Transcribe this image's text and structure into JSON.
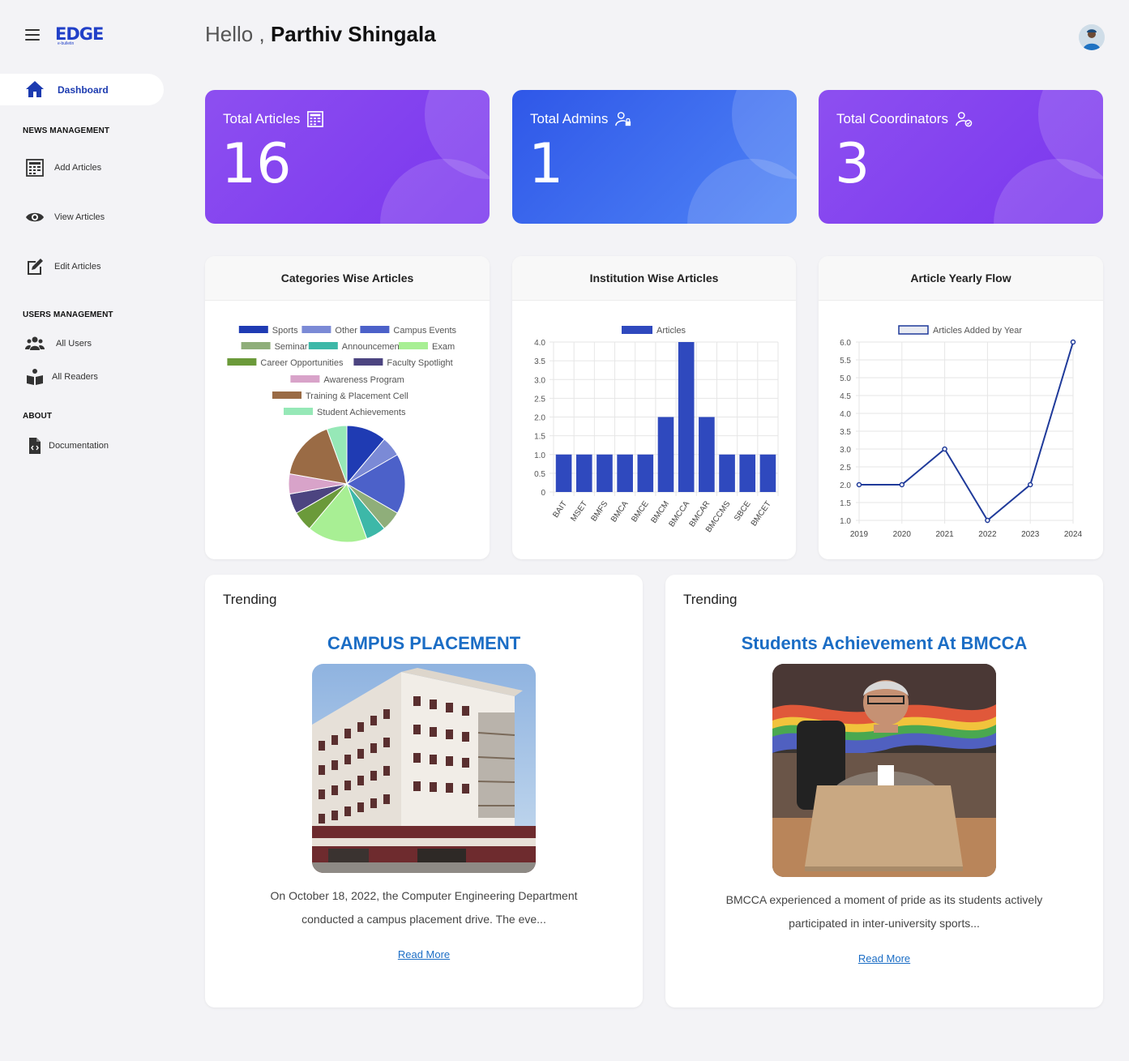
{
  "app": {
    "logo_text": "EDGE",
    "logo_sub": "e-bulletin"
  },
  "greeting": {
    "hello": "Hello ,",
    "name": "Parthiv Shingala"
  },
  "sidebar": {
    "dashboard": "Dashboard",
    "news_title": "NEWS MANAGEMENT",
    "news_items": [
      "Add Articles",
      "View Articles",
      "Edit Articles"
    ],
    "users_title": "USERS MANAGEMENT",
    "users_items": [
      "All Users",
      "All Readers"
    ],
    "about_title": "ABOUT",
    "about_items": [
      "Documentation"
    ]
  },
  "stats": [
    {
      "label": "Total Articles",
      "value": "16"
    },
    {
      "label": "Total Admins",
      "value": "1"
    },
    {
      "label": "Total Coordinators",
      "value": "3"
    }
  ],
  "cards": {
    "pie_title": "Categories Wise Articles",
    "bar_title": "Institution Wise Articles",
    "line_title": "Article Yearly Flow"
  },
  "chart_data": [
    {
      "type": "pie",
      "title": "Categories Wise Articles",
      "categories": [
        "Sports",
        "Other",
        "Campus Events",
        "Seminar",
        "Announcement",
        "Exam",
        "Career Opportunities",
        "Faculty Spotlight",
        "Awareness Program",
        "Training & Placement Cell",
        "Student Achievements"
      ],
      "values": [
        2,
        1,
        3,
        1,
        1,
        3,
        1,
        1,
        1,
        3,
        1
      ],
      "colors": [
        "#1f3bb3",
        "#7b8ad6",
        "#4c61c9",
        "#8fae7a",
        "#3db8a8",
        "#a8ef94",
        "#6b9a3a",
        "#4c4480",
        "#d8a3c9",
        "#9a6b45",
        "#96e8b7"
      ],
      "legend": "top"
    },
    {
      "type": "bar",
      "title": "Institution Wise Articles",
      "categories": [
        "BAIT",
        "MSET",
        "BMFS",
        "BMCA",
        "BMCE",
        "BMCM",
        "BMCCA",
        "BMCAR",
        "BMCCMS",
        "SBCE",
        "BMCET"
      ],
      "series": [
        {
          "name": "Articles",
          "values": [
            1,
            1,
            1,
            1,
            1,
            2,
            4,
            2,
            1,
            1,
            1
          ]
        }
      ],
      "ylim": [
        0,
        4
      ],
      "yticks": [
        "0",
        "0.5",
        "1.0",
        "1.5",
        "2.0",
        "2.5",
        "3.0",
        "3.5",
        "4.0"
      ],
      "color": "#2f49be",
      "grid": true,
      "legend": "top"
    },
    {
      "type": "line",
      "title": "Article Yearly Flow",
      "x": [
        "2019",
        "2020",
        "2021",
        "2022",
        "2023",
        "2024"
      ],
      "series": [
        {
          "name": "Articles Added by Year",
          "values": [
            2,
            2,
            3,
            1,
            2,
            6
          ]
        }
      ],
      "ylim": [
        1,
        6
      ],
      "yticks": [
        "1.0",
        "1.5",
        "2.0",
        "2.5",
        "3.0",
        "3.5",
        "4.0",
        "4.5",
        "5.0",
        "5.5",
        "6.0"
      ],
      "color": "#1f3a9a",
      "grid": true,
      "legend": "top"
    }
  ],
  "trending": [
    {
      "label": "Trending",
      "title": "CAMPUS PLACEMENT",
      "desc_line1": "On October 18, 2022, the Computer Engineering Department",
      "desc_line2": "conducted a campus placement drive. The eve...",
      "more": "Read More"
    },
    {
      "label": "Trending",
      "title": "Students Achievement At BMCCA",
      "desc_line1": "BMCCA experienced a moment of pride as its students actively",
      "desc_line2": "participated in inter-university sports...",
      "more": "Read More"
    }
  ]
}
